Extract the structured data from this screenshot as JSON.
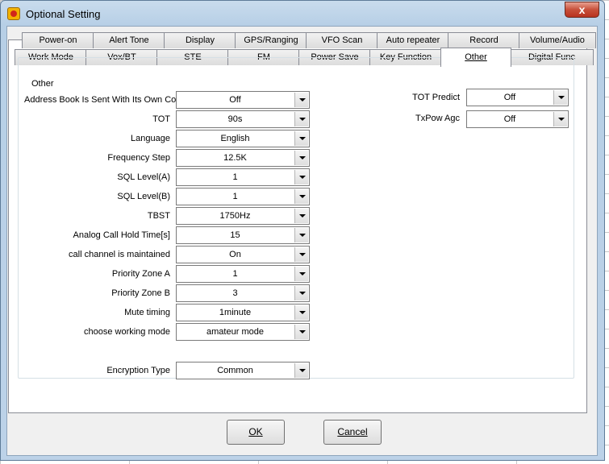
{
  "window": {
    "title": "Optional Setting",
    "close_label": "x"
  },
  "tabs_row1": [
    "Power-on",
    "Alert Tone",
    "Display",
    "GPS/Ranging",
    "VFO Scan",
    "Auto repeater",
    "Record",
    "Volume/Audio"
  ],
  "tabs_row2": [
    "Work Mode",
    "Vox/BT",
    "STE",
    "FM",
    "Power Save",
    "Key Function",
    "Other",
    "Digital Func"
  ],
  "active_tab": "Other",
  "group_title": "Other",
  "fields_left": [
    {
      "label": "Address Book Is Sent With Its Own Code",
      "value": "Off"
    },
    {
      "label": "TOT",
      "value": "90s"
    },
    {
      "label": "Language",
      "value": "English"
    },
    {
      "label": "Frequency Step",
      "value": "12.5K"
    },
    {
      "label": "SQL Level(A)",
      "value": "1"
    },
    {
      "label": "SQL Level(B)",
      "value": "1"
    },
    {
      "label": "TBST",
      "value": "1750Hz"
    },
    {
      "label": "Analog Call Hold Time[s]",
      "value": "15"
    },
    {
      "label": "call channel is maintained",
      "value": "On"
    },
    {
      "label": "Priority Zone A",
      "value": "1"
    },
    {
      "label": "Priority Zone B",
      "value": "3"
    },
    {
      "label": "Mute timing",
      "value": "1minute"
    },
    {
      "label": "choose working mode",
      "value": "amateur mode"
    }
  ],
  "encryption": {
    "label": "Encryption Type",
    "value": "Common"
  },
  "fields_right": [
    {
      "label": "TOT Predict",
      "value": "Off"
    },
    {
      "label": "TxPow Agc",
      "value": "Off"
    }
  ],
  "buttons": {
    "ok": "OK",
    "cancel": "Cancel"
  }
}
